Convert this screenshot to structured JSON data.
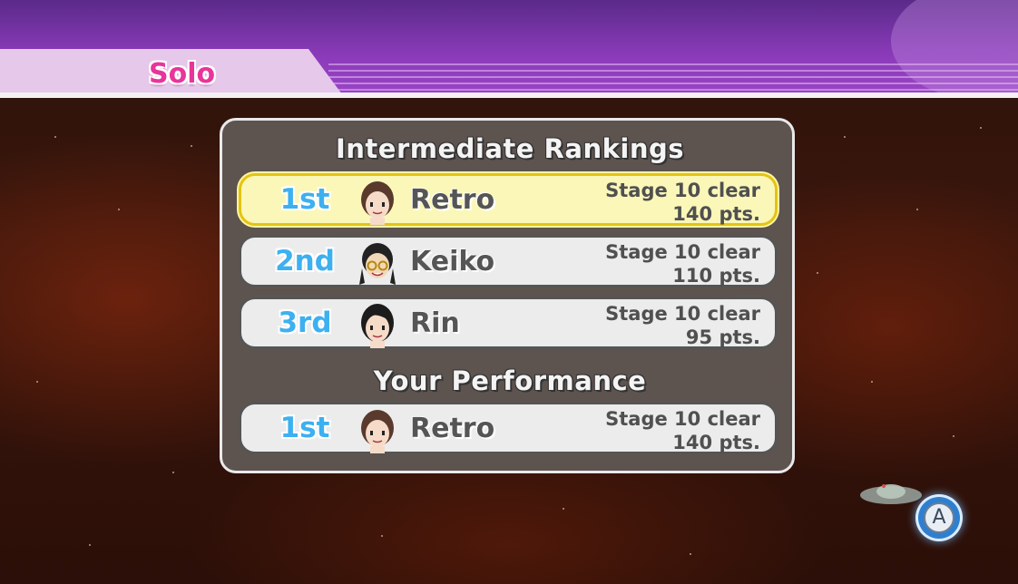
{
  "header": {
    "mode_label": "Solo"
  },
  "rankings": {
    "heading": "Intermediate Rankings",
    "rows": [
      {
        "rank": "1st",
        "name": "Retro",
        "stage": "Stage 10 clear",
        "points": "140 pts.",
        "highlight": true
      },
      {
        "rank": "2nd",
        "name": "Keiko",
        "stage": "Stage 10 clear",
        "points": "110 pts."
      },
      {
        "rank": "3rd",
        "name": "Rin",
        "stage": "Stage 10 clear",
        "points": "95 pts."
      }
    ]
  },
  "performance": {
    "heading": "Your Performance",
    "row": {
      "rank": "1st",
      "name": "Retro",
      "stage": "Stage 10 clear",
      "points": "140 pts."
    }
  },
  "controls": {
    "a_button_label": "A",
    "a_button_icon": "a-button-icon"
  },
  "colors": {
    "rank_blue": "#3db0f0",
    "highlight_yellow": "#fbf7b8",
    "topbar_purple": "#8a3ab8",
    "tab_pink": "#e8359a"
  }
}
